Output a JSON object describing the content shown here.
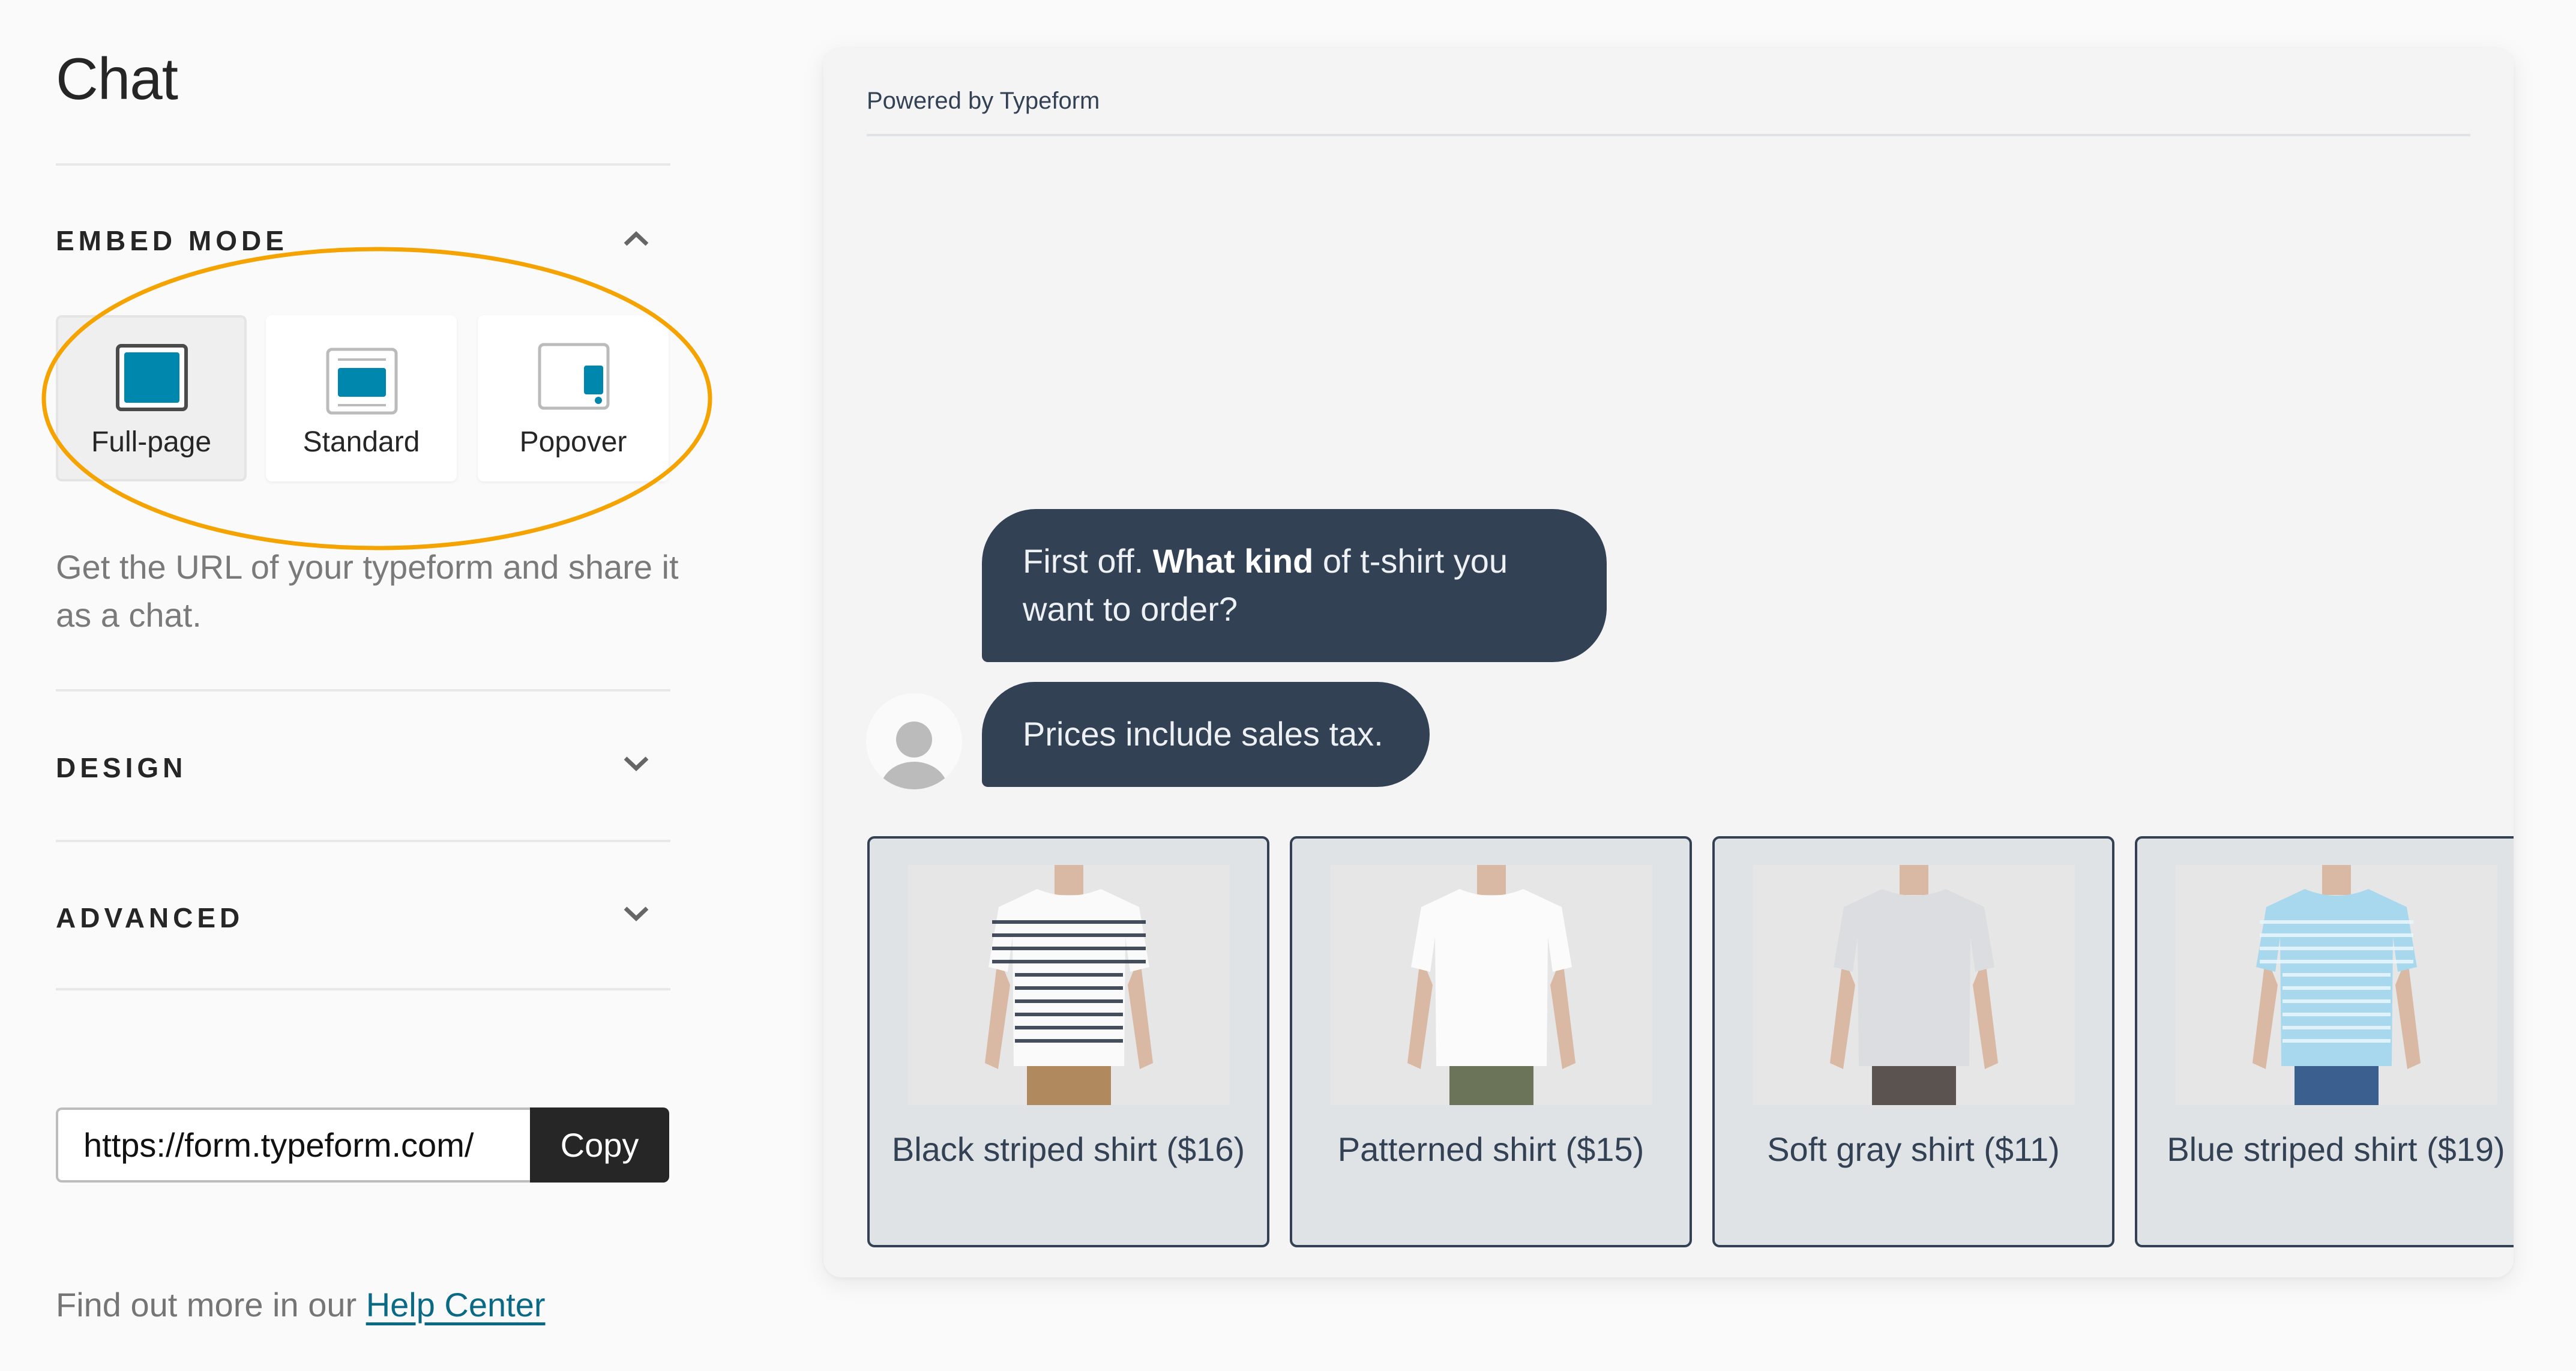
{
  "sidebar": {
    "title": "Chat",
    "embed_mode": {
      "heading": "EMBED MODE",
      "expanded": true,
      "options": [
        {
          "label": "Full-page",
          "icon": "full-page-mode-icon",
          "selected": true
        },
        {
          "label": "Standard",
          "icon": "standard-mode-icon",
          "selected": false
        },
        {
          "label": "Popover",
          "icon": "popover-mode-icon",
          "selected": false
        }
      ],
      "description": "Get the URL of your typeform and share it as a chat."
    },
    "design": {
      "heading": "DESIGN",
      "expanded": false
    },
    "advanced": {
      "heading": "ADVANCED",
      "expanded": false
    },
    "share": {
      "url_value": "https://form.typeform.com/",
      "copy_label": "Copy"
    },
    "help": {
      "prefix": "Find out more in our ",
      "link_label": "Help Center"
    }
  },
  "annotation": {
    "shape": "ellipse",
    "color": "#f5a300",
    "target": "embed-mode-options"
  },
  "preview": {
    "powered_by": "Powered by Typeform",
    "messages": [
      {
        "parts": [
          {
            "text": "First off. ",
            "bold": false
          },
          {
            "text": "What kind",
            "bold": true
          },
          {
            "text": " of t-shirt you want to order?",
            "bold": false
          }
        ]
      },
      {
        "parts": [
          {
            "text": "Prices include sales tax.",
            "bold": false
          }
        ],
        "avatar": "avatar-placeholder-icon"
      }
    ],
    "choices": [
      {
        "label": "Black striped shirt ($16)",
        "shirt_color": "#fafafa",
        "stripes": "#2f3a4a",
        "pants_color": "#b08a5e"
      },
      {
        "label": "Patterned shirt ($15)",
        "shirt_color": "#fbfbfb",
        "stripes": null,
        "pants_color": "#6b7358"
      },
      {
        "label": "Soft gray shirt ($11)",
        "shirt_color": "#dcdde0",
        "stripes": null,
        "pants_color": "#5a5350"
      },
      {
        "label": "Blue striped shirt ($19)",
        "shirt_color": "#a8d8ee",
        "stripes": "#e8f5fb",
        "pants_color": "#3b5f8e"
      }
    ]
  },
  "colors": {
    "accent": "#0087ad",
    "bubble_bg": "#334155",
    "link": "#0a6a85",
    "copy_button_bg": "#262626"
  }
}
